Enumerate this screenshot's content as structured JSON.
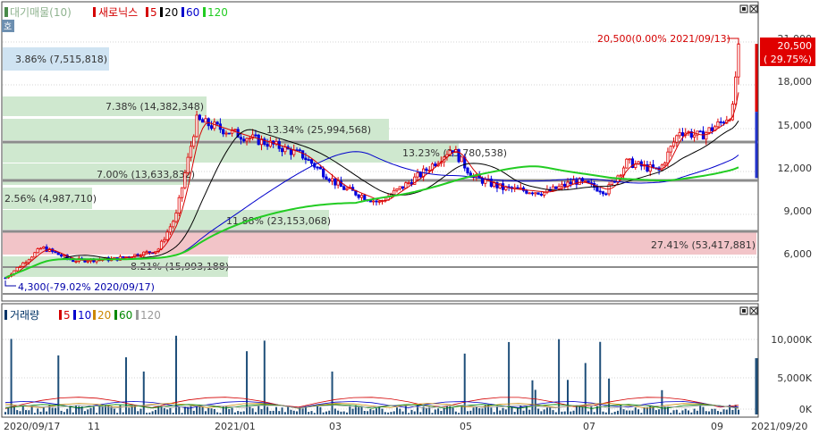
{
  "price_panel": {
    "legend": {
      "indicator": "대기매물(10)",
      "stock": "새로닉스",
      "ma_labels": [
        "5",
        "20",
        "60",
        "120"
      ],
      "ma_colors": [
        "#d40000",
        "#000000",
        "#0000cc",
        "#22cc22"
      ]
    },
    "side_button": "호",
    "last_price_tag": "20,500",
    "last_change_tag": "( 29.75%)",
    "high_note": "20,500(0.00% 2021/09/13)",
    "low_note": "4,300(-79.02% 2020/09/17)",
    "supply_zones": [
      {
        "label": "3.86% (7,515,818)"
      },
      {
        "label": "7.38% (14,382,348)"
      },
      {
        "label": "13.34% (25,994,568)"
      },
      {
        "label": "13.23% (25,780,538)"
      },
      {
        "label": "7.00% (13,633,832)"
      },
      {
        "label": "2.56% (4,987,710)"
      },
      {
        "label": "11.88% (23,153,068)"
      },
      {
        "label": "27.41% (53,417,881)"
      },
      {
        "label": "8.21% (15,993,188)"
      }
    ],
    "supply_zone_colors": {
      "normal": "#cfe8cf",
      "max": "#f2c4c8",
      "highlight": "#cfe3f2"
    }
  },
  "volume_panel": {
    "legend": {
      "indicator": "거래량",
      "ma_labels": [
        "5",
        "10",
        "20",
        "60",
        "120"
      ],
      "ma_colors": [
        "#d40000",
        "#0000cc",
        "#cc8800",
        "#008800",
        "#999999"
      ]
    }
  },
  "chart_data": [
    {
      "type": "candlestick",
      "title": "새로닉스",
      "y_ticks": [
        "21,000",
        "18,000",
        "15,000",
        "12,000",
        "9,000",
        "6,000"
      ],
      "ylim": [
        3500,
        22500
      ],
      "x_ticks": [
        "2020/09/17",
        "11",
        "2021/01",
        "03",
        "05",
        "07",
        "09",
        "2021/09/20"
      ],
      "date_range": [
        "2020/09/17",
        "2021/09/20"
      ],
      "high": 20500,
      "low": 4300,
      "last_close": 20500,
      "last_change_pct": 29.75,
      "price_path": [
        [
          "2020/09/17",
          4300
        ],
        [
          "2020/10/05",
          6400
        ],
        [
          "2020/10/20",
          5500
        ],
        [
          "2020/11/10",
          5600
        ],
        [
          "2020/12/01",
          6200
        ],
        [
          "2020/12/10",
          8600
        ],
        [
          "2020/12/20",
          15200
        ],
        [
          "2021/01/10",
          14200
        ],
        [
          "2021/01/25",
          13600
        ],
        [
          "2021/02/10",
          12800
        ],
        [
          "2021/03/01",
          10600
        ],
        [
          "2021/03/20",
          9500
        ],
        [
          "2021/04/10",
          11500
        ],
        [
          "2021/04/25",
          13300
        ],
        [
          "2021/05/05",
          11300
        ],
        [
          "2021/05/20",
          10500
        ],
        [
          "2021/06/10",
          10200
        ],
        [
          "2021/06/25",
          11000
        ],
        [
          "2021/07/10",
          10300
        ],
        [
          "2021/07/20",
          12300
        ],
        [
          "2021/08/05",
          11700
        ],
        [
          "2021/08/15",
          14500
        ],
        [
          "2021/08/25",
          14100
        ],
        [
          "2021/09/05",
          15100
        ],
        [
          "2021/09/10",
          15800
        ],
        [
          "2021/09/13",
          20500
        ]
      ],
      "volume_ticks": [
        "10,000K",
        "5,000K",
        "0K"
      ],
      "volume_ylim": [
        0,
        12500
      ]
    }
  ]
}
